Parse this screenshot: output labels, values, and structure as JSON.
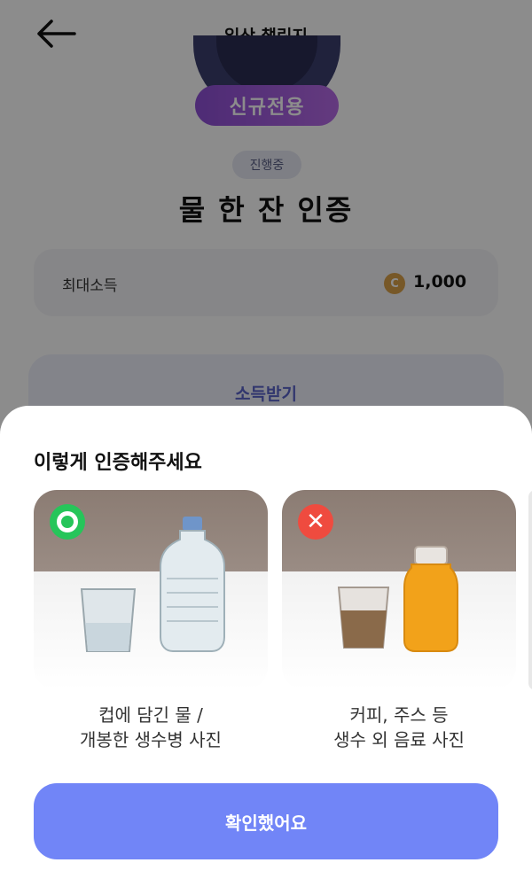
{
  "header": {
    "title": "일상 챌린지",
    "back_icon": "arrow-left-icon"
  },
  "challenge": {
    "badge": "신규전용",
    "status": "진행중",
    "title": "물 한 잔 인증",
    "reward_label": "최대소득",
    "reward_coin_symbol": "C",
    "reward_value": "1,000",
    "claim_label": "소득받기"
  },
  "sheet": {
    "title": "이렇게 인증해주세요",
    "examples": [
      {
        "mark": "check-circle-icon",
        "caption_line1": "컵에 담긴 물 /",
        "caption_line2": "개봉한 생수병 사진"
      },
      {
        "mark": "x-icon",
        "x_glyph": "✕",
        "caption_line1": "커피, 주스 등",
        "caption_line2": "생수 외 음료 사진"
      }
    ],
    "confirm_label": "확인했어요"
  },
  "colors": {
    "accent": "#7185f7",
    "ok": "#26c55a",
    "ng": "#ef4b3f",
    "badge": "#8e4fd6"
  }
}
